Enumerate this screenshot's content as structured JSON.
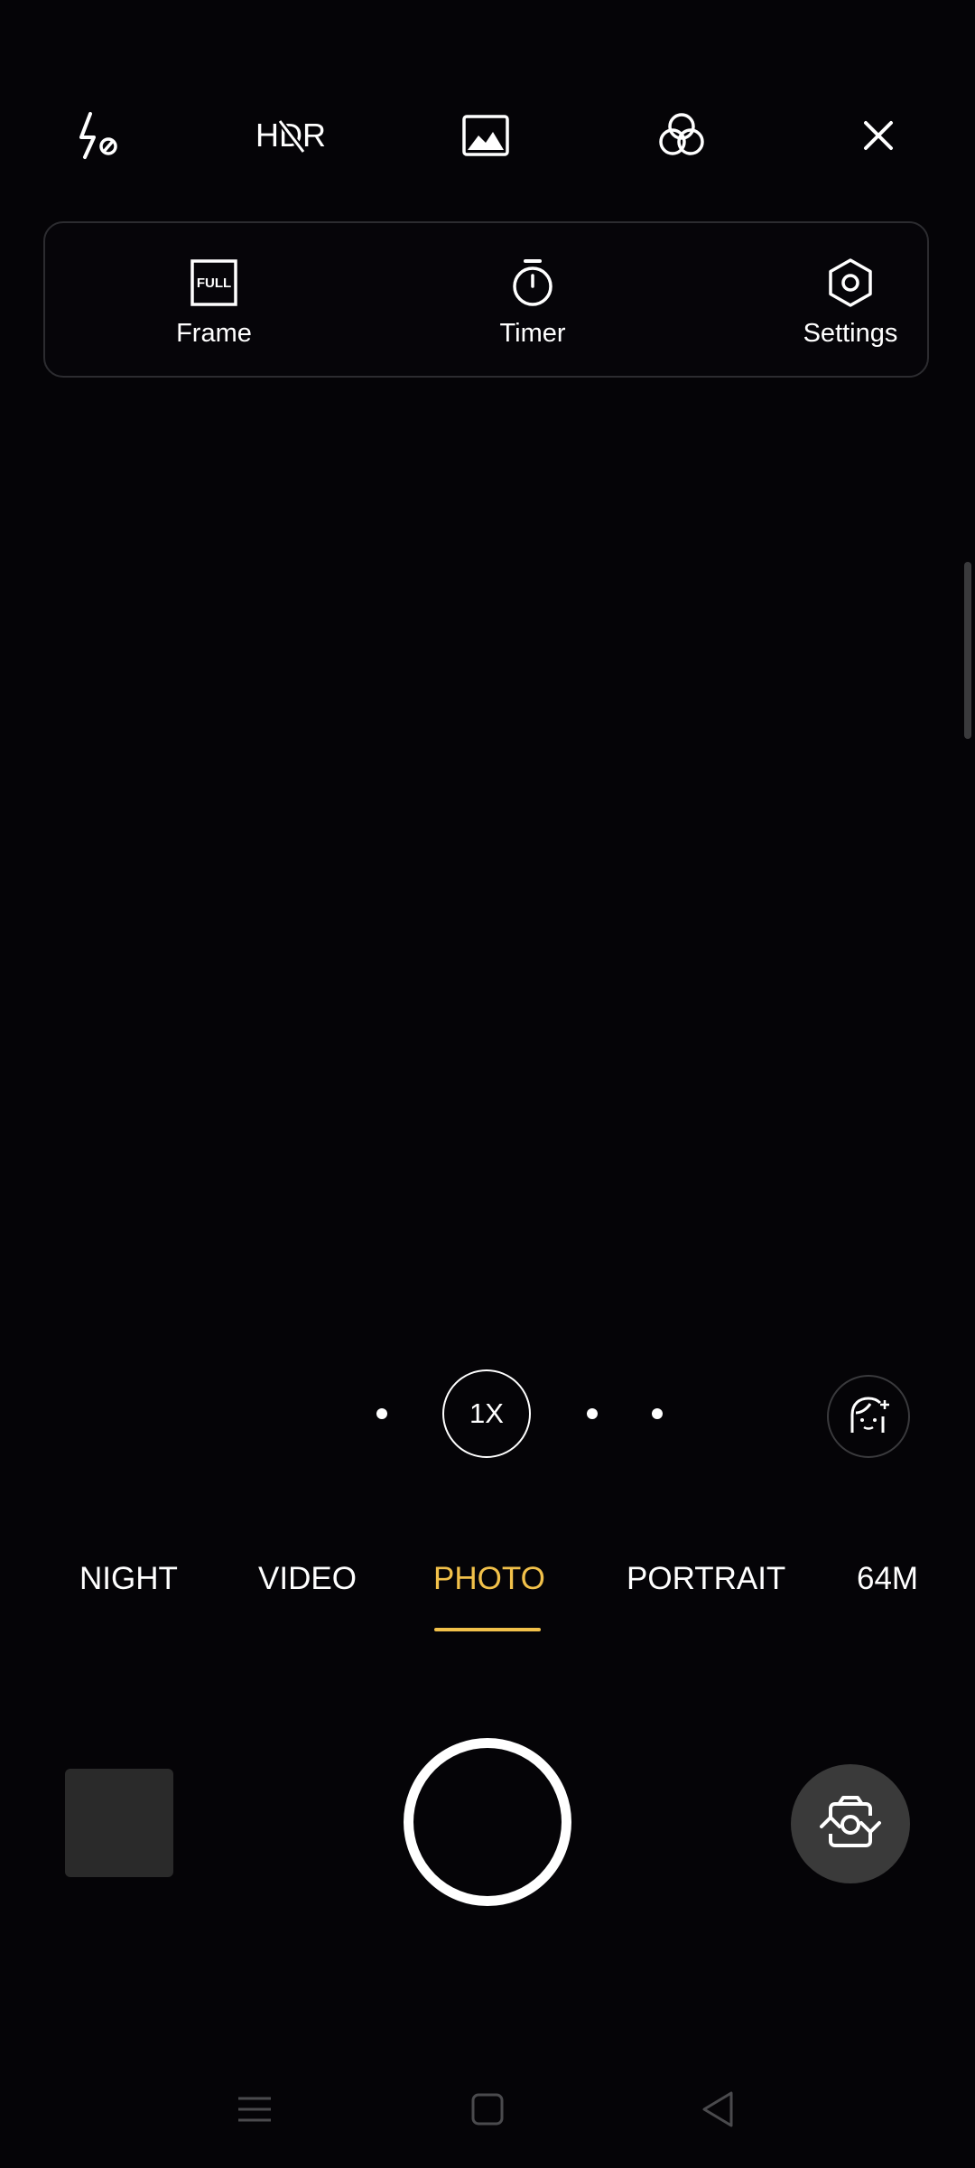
{
  "top_bar": {
    "icons": [
      "flash-off-icon",
      "hdr-off-icon",
      "photo-ratio-icon",
      "filter-icon",
      "close-icon"
    ],
    "hdr_text": "HDR"
  },
  "settings_panel": {
    "frame": {
      "label": "Frame",
      "badge": "FULL",
      "icon": "frame-full-icon"
    },
    "timer": {
      "label": "Timer",
      "icon": "timer-icon"
    },
    "settings": {
      "label": "Settings",
      "icon": "settings-hexagon-icon"
    }
  },
  "zoom": {
    "current": "1X"
  },
  "modes": {
    "items": [
      "NIGHT",
      "VIDEO",
      "PHOTO",
      "PORTRAIT",
      "64M"
    ],
    "active": "PHOTO"
  },
  "colors": {
    "background": "#050407",
    "accent": "#f2c14a",
    "panel_border": "#2c2c30",
    "flip_button": "#3a3a3a",
    "thumbnail": "#2a2a2a",
    "nav_icons": "#4a4a4d"
  },
  "bottom_nav": {
    "icons": [
      "menu-icon",
      "home-icon",
      "back-icon"
    ]
  }
}
